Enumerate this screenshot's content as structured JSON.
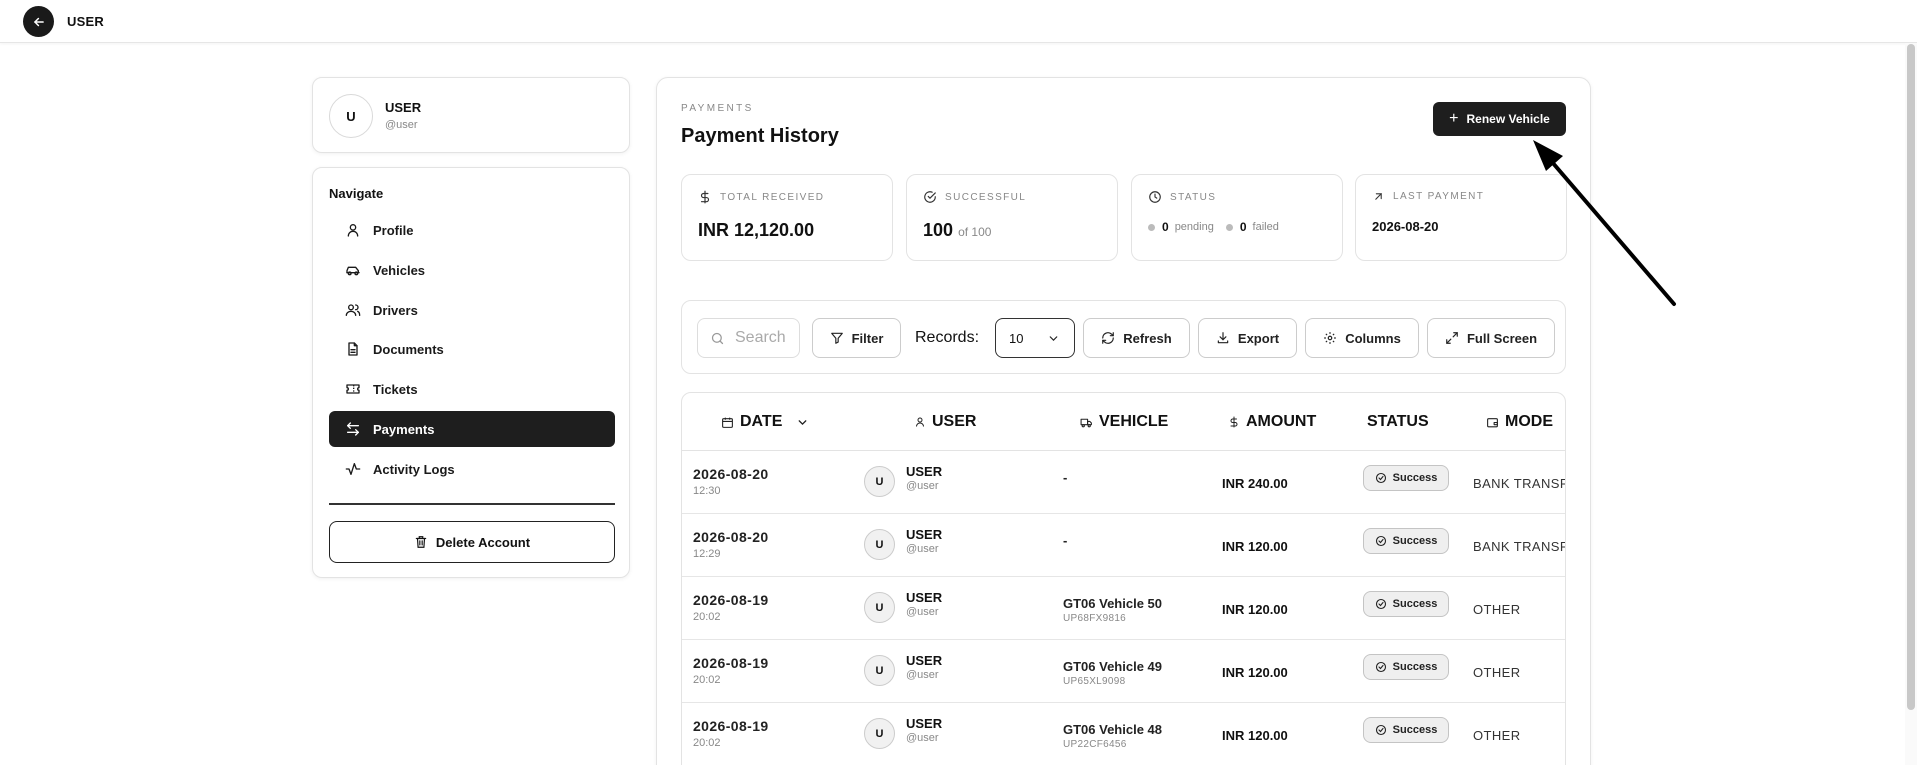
{
  "topbar": {
    "title": "USER"
  },
  "user_card": {
    "avatar_initial": "U",
    "name": "USER",
    "handle": "@user"
  },
  "nav": {
    "heading": "Navigate",
    "items": [
      {
        "label": "Profile",
        "icon": "user-icon"
      },
      {
        "label": "Vehicles",
        "icon": "car-icon"
      },
      {
        "label": "Drivers",
        "icon": "users-icon"
      },
      {
        "label": "Documents",
        "icon": "document-icon"
      },
      {
        "label": "Tickets",
        "icon": "ticket-icon"
      },
      {
        "label": "Payments",
        "icon": "arrows-left-right-icon",
        "active": true
      },
      {
        "label": "Activity Logs",
        "icon": "activity-icon"
      }
    ],
    "delete_label": "Delete Account"
  },
  "main": {
    "eyebrow": "PAYMENTS",
    "title": "Payment History",
    "renew_label": "Renew Vehicle"
  },
  "stats": {
    "total": {
      "label": "TOTAL RECEIVED",
      "value": "INR 12,120.00"
    },
    "successful": {
      "label": "SUCCESSFUL",
      "value": "100",
      "of": "of 100"
    },
    "status": {
      "label": "STATUS",
      "pending_count": "0",
      "pending_label": "pending",
      "failed_count": "0",
      "failed_label": "failed"
    },
    "last": {
      "label": "LAST PAYMENT",
      "value": "2026-08-20"
    }
  },
  "toolbar": {
    "search_placeholder": "Search",
    "filter_label": "Filter",
    "records_label": "Records:",
    "records_value": "10",
    "refresh_label": "Refresh",
    "export_label": "Export",
    "columns_label": "Columns",
    "fullscreen_label": "Full Screen"
  },
  "table": {
    "headers": {
      "date": "DATE",
      "user": "USER",
      "vehicle": "VEHICLE",
      "amount": "AMOUNT",
      "status": "STATUS",
      "mode": "MODE"
    },
    "rows": [
      {
        "date": "2026-08-20",
        "time": "12:30",
        "avatar": "U",
        "user": "USER",
        "handle": "@user",
        "vehicle": "-",
        "plate": "",
        "amount": "INR 240.00",
        "status": "Success",
        "mode": "BANK TRANSFER"
      },
      {
        "date": "2026-08-20",
        "time": "12:29",
        "avatar": "U",
        "user": "USER",
        "handle": "@user",
        "vehicle": "-",
        "plate": "",
        "amount": "INR 120.00",
        "status": "Success",
        "mode": "BANK TRANSFER"
      },
      {
        "date": "2026-08-19",
        "time": "20:02",
        "avatar": "U",
        "user": "USER",
        "handle": "@user",
        "vehicle": "GT06 Vehicle 50",
        "plate": "UP68FX9816",
        "amount": "INR 120.00",
        "status": "Success",
        "mode": "OTHER"
      },
      {
        "date": "2026-08-19",
        "time": "20:02",
        "avatar": "U",
        "user": "USER",
        "handle": "@user",
        "vehicle": "GT06 Vehicle 49",
        "plate": "UP65XL9098",
        "amount": "INR 120.00",
        "status": "Success",
        "mode": "OTHER"
      },
      {
        "date": "2026-08-19",
        "time": "20:02",
        "avatar": "U",
        "user": "USER",
        "handle": "@user",
        "vehicle": "GT06 Vehicle 48",
        "plate": "UP22CF6456",
        "amount": "INR 120.00",
        "status": "Success",
        "mode": "OTHER"
      }
    ]
  },
  "colors": {
    "primary": "#1e1e1e",
    "border": "#e3e3e3",
    "muted": "#888888",
    "badge_bg": "#efefef"
  }
}
